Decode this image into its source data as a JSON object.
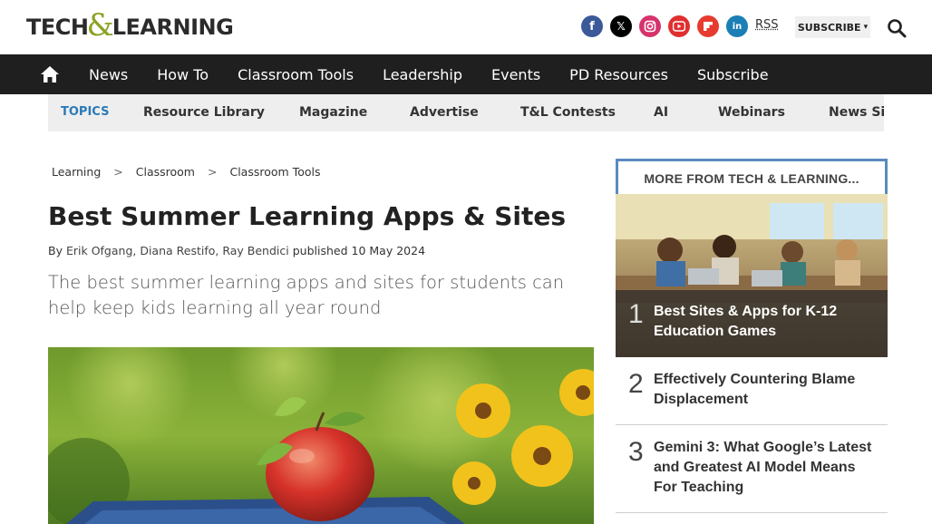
{
  "header": {
    "logo": {
      "part1": "TECH",
      "amp": "&",
      "part2": "LEARNING"
    },
    "socials": [
      {
        "name": "facebook",
        "glyph": "f"
      },
      {
        "name": "x",
        "glyph": "𝕏"
      },
      {
        "name": "instagram",
        "glyph": "◎"
      },
      {
        "name": "youtube",
        "glyph": "▶"
      },
      {
        "name": "flipboard",
        "glyph": "f"
      },
      {
        "name": "linkedin",
        "glyph": "in"
      }
    ],
    "rss_label": "RSS",
    "subscribe_label": "SUBSCRIBE",
    "subscribe_caret": "▾"
  },
  "nav": {
    "items": [
      "News",
      "How To",
      "Classroom Tools",
      "Leadership",
      "Events",
      "PD Resources",
      "Subscribe"
    ]
  },
  "topics": {
    "label": "TOPICS",
    "items": [
      "Resource Library",
      "Magazine",
      "Advertise",
      "T&L Contests",
      "AI",
      "Webinars",
      "News Sig"
    ]
  },
  "breadcrumb": {
    "items": [
      "Learning",
      "Classroom",
      "Classroom Tools"
    ],
    "separator": ">"
  },
  "article": {
    "title": "Best Summer Learning Apps & Sites",
    "by_prefix": "By",
    "authors": "Erik Ofgang, Diana Restifo, Ray Bendici",
    "published_prefix": "published",
    "date": "10 May 2024",
    "subhead": "The best summer learning apps and sites for students can help keep kids learning all year round"
  },
  "sidebar": {
    "heading": "MORE FROM TECH & LEARNING...",
    "items": [
      {
        "rank": "1",
        "title": "Best Sites & Apps for K-12 Education Games"
      },
      {
        "rank": "2",
        "title": "Effectively Countering Blame Displacement"
      },
      {
        "rank": "3",
        "title": "Gemini 3: What Google’s Latest and Greatest AI Model Means For Teaching"
      }
    ]
  },
  "colors": {
    "nav_bg": "#1f1f1f",
    "topics_accent": "#2a7ab8",
    "sidebar_border": "#5a8bbd",
    "logo_amp": "#8aa325"
  }
}
